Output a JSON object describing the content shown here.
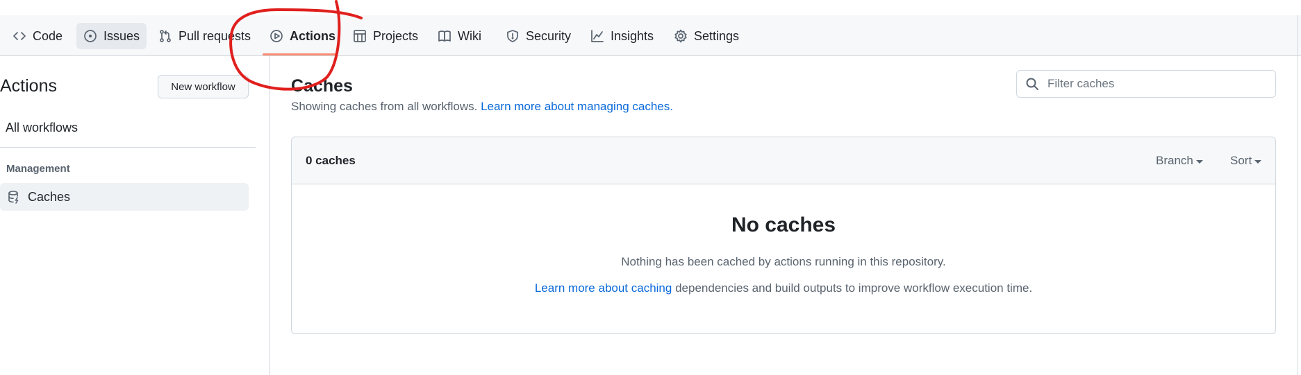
{
  "nav": {
    "items": [
      {
        "label": "Code",
        "icon": "code-icon"
      },
      {
        "label": "Issues",
        "icon": "issue-icon"
      },
      {
        "label": "Pull requests",
        "icon": "pull-request-icon"
      },
      {
        "label": "Actions",
        "icon": "play-icon"
      },
      {
        "label": "Projects",
        "icon": "table-icon"
      },
      {
        "label": "Wiki",
        "icon": "book-icon"
      },
      {
        "label": "Security",
        "icon": "shield-icon"
      },
      {
        "label": "Insights",
        "icon": "graph-icon"
      },
      {
        "label": "Settings",
        "icon": "gear-icon"
      }
    ],
    "active": "Actions",
    "accent": "#fd8c73"
  },
  "sidebar": {
    "title": "Actions",
    "new_workflow_label": "New workflow",
    "all_workflows_label": "All workflows",
    "management_heading": "Management",
    "caches_label": "Caches"
  },
  "main": {
    "title": "Caches",
    "description": "Showing caches from all workflows.",
    "description_link": "Learn more about managing caches.",
    "filter_placeholder": "Filter caches",
    "count_label": "0 caches",
    "branch_label": "Branch",
    "sort_label": "Sort",
    "empty_title": "No caches",
    "empty_line1": "Nothing has been cached by actions running in this repository.",
    "empty_line2_link": "Learn more about caching",
    "empty_line2_rest": "dependencies and build outputs to improve workflow execution time."
  },
  "colors": {
    "link": "#0969da",
    "annotation": "#e0201e"
  }
}
